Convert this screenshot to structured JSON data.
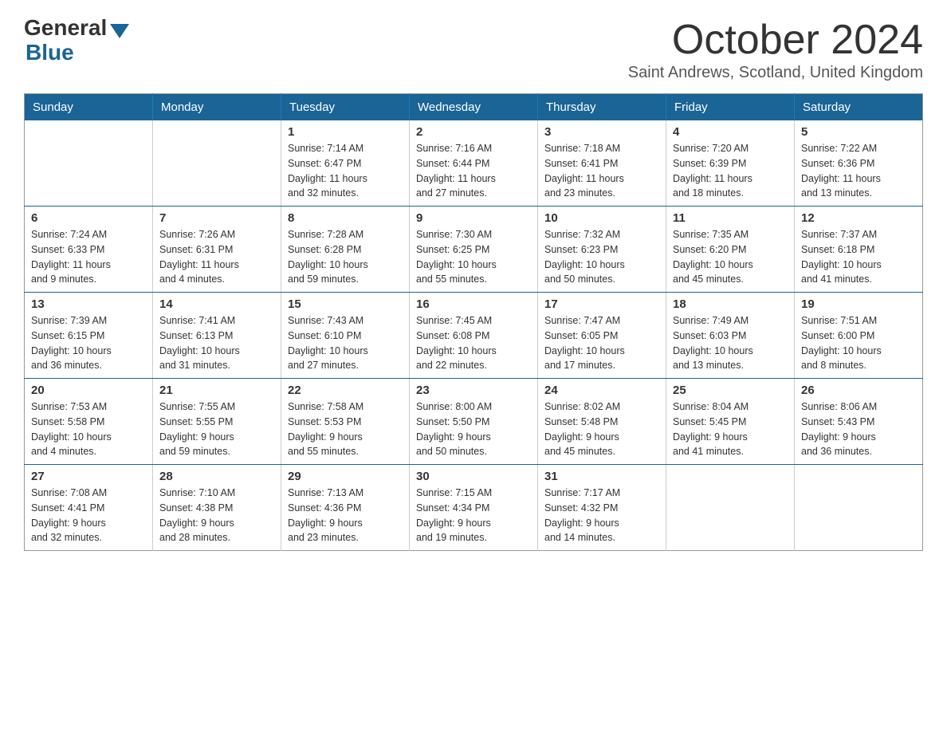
{
  "logo": {
    "general": "General",
    "blue": "Blue"
  },
  "title": "October 2024",
  "location": "Saint Andrews, Scotland, United Kingdom",
  "weekdays": [
    "Sunday",
    "Monday",
    "Tuesday",
    "Wednesday",
    "Thursday",
    "Friday",
    "Saturday"
  ],
  "weeks": [
    [
      {
        "day": "",
        "info": ""
      },
      {
        "day": "",
        "info": ""
      },
      {
        "day": "1",
        "info": "Sunrise: 7:14 AM\nSunset: 6:47 PM\nDaylight: 11 hours\nand 32 minutes."
      },
      {
        "day": "2",
        "info": "Sunrise: 7:16 AM\nSunset: 6:44 PM\nDaylight: 11 hours\nand 27 minutes."
      },
      {
        "day": "3",
        "info": "Sunrise: 7:18 AM\nSunset: 6:41 PM\nDaylight: 11 hours\nand 23 minutes."
      },
      {
        "day": "4",
        "info": "Sunrise: 7:20 AM\nSunset: 6:39 PM\nDaylight: 11 hours\nand 18 minutes."
      },
      {
        "day": "5",
        "info": "Sunrise: 7:22 AM\nSunset: 6:36 PM\nDaylight: 11 hours\nand 13 minutes."
      }
    ],
    [
      {
        "day": "6",
        "info": "Sunrise: 7:24 AM\nSunset: 6:33 PM\nDaylight: 11 hours\nand 9 minutes."
      },
      {
        "day": "7",
        "info": "Sunrise: 7:26 AM\nSunset: 6:31 PM\nDaylight: 11 hours\nand 4 minutes."
      },
      {
        "day": "8",
        "info": "Sunrise: 7:28 AM\nSunset: 6:28 PM\nDaylight: 10 hours\nand 59 minutes."
      },
      {
        "day": "9",
        "info": "Sunrise: 7:30 AM\nSunset: 6:25 PM\nDaylight: 10 hours\nand 55 minutes."
      },
      {
        "day": "10",
        "info": "Sunrise: 7:32 AM\nSunset: 6:23 PM\nDaylight: 10 hours\nand 50 minutes."
      },
      {
        "day": "11",
        "info": "Sunrise: 7:35 AM\nSunset: 6:20 PM\nDaylight: 10 hours\nand 45 minutes."
      },
      {
        "day": "12",
        "info": "Sunrise: 7:37 AM\nSunset: 6:18 PM\nDaylight: 10 hours\nand 41 minutes."
      }
    ],
    [
      {
        "day": "13",
        "info": "Sunrise: 7:39 AM\nSunset: 6:15 PM\nDaylight: 10 hours\nand 36 minutes."
      },
      {
        "day": "14",
        "info": "Sunrise: 7:41 AM\nSunset: 6:13 PM\nDaylight: 10 hours\nand 31 minutes."
      },
      {
        "day": "15",
        "info": "Sunrise: 7:43 AM\nSunset: 6:10 PM\nDaylight: 10 hours\nand 27 minutes."
      },
      {
        "day": "16",
        "info": "Sunrise: 7:45 AM\nSunset: 6:08 PM\nDaylight: 10 hours\nand 22 minutes."
      },
      {
        "day": "17",
        "info": "Sunrise: 7:47 AM\nSunset: 6:05 PM\nDaylight: 10 hours\nand 17 minutes."
      },
      {
        "day": "18",
        "info": "Sunrise: 7:49 AM\nSunset: 6:03 PM\nDaylight: 10 hours\nand 13 minutes."
      },
      {
        "day": "19",
        "info": "Sunrise: 7:51 AM\nSunset: 6:00 PM\nDaylight: 10 hours\nand 8 minutes."
      }
    ],
    [
      {
        "day": "20",
        "info": "Sunrise: 7:53 AM\nSunset: 5:58 PM\nDaylight: 10 hours\nand 4 minutes."
      },
      {
        "day": "21",
        "info": "Sunrise: 7:55 AM\nSunset: 5:55 PM\nDaylight: 9 hours\nand 59 minutes."
      },
      {
        "day": "22",
        "info": "Sunrise: 7:58 AM\nSunset: 5:53 PM\nDaylight: 9 hours\nand 55 minutes."
      },
      {
        "day": "23",
        "info": "Sunrise: 8:00 AM\nSunset: 5:50 PM\nDaylight: 9 hours\nand 50 minutes."
      },
      {
        "day": "24",
        "info": "Sunrise: 8:02 AM\nSunset: 5:48 PM\nDaylight: 9 hours\nand 45 minutes."
      },
      {
        "day": "25",
        "info": "Sunrise: 8:04 AM\nSunset: 5:45 PM\nDaylight: 9 hours\nand 41 minutes."
      },
      {
        "day": "26",
        "info": "Sunrise: 8:06 AM\nSunset: 5:43 PM\nDaylight: 9 hours\nand 36 minutes."
      }
    ],
    [
      {
        "day": "27",
        "info": "Sunrise: 7:08 AM\nSunset: 4:41 PM\nDaylight: 9 hours\nand 32 minutes."
      },
      {
        "day": "28",
        "info": "Sunrise: 7:10 AM\nSunset: 4:38 PM\nDaylight: 9 hours\nand 28 minutes."
      },
      {
        "day": "29",
        "info": "Sunrise: 7:13 AM\nSunset: 4:36 PM\nDaylight: 9 hours\nand 23 minutes."
      },
      {
        "day": "30",
        "info": "Sunrise: 7:15 AM\nSunset: 4:34 PM\nDaylight: 9 hours\nand 19 minutes."
      },
      {
        "day": "31",
        "info": "Sunrise: 7:17 AM\nSunset: 4:32 PM\nDaylight: 9 hours\nand 14 minutes."
      },
      {
        "day": "",
        "info": ""
      },
      {
        "day": "",
        "info": ""
      }
    ]
  ]
}
